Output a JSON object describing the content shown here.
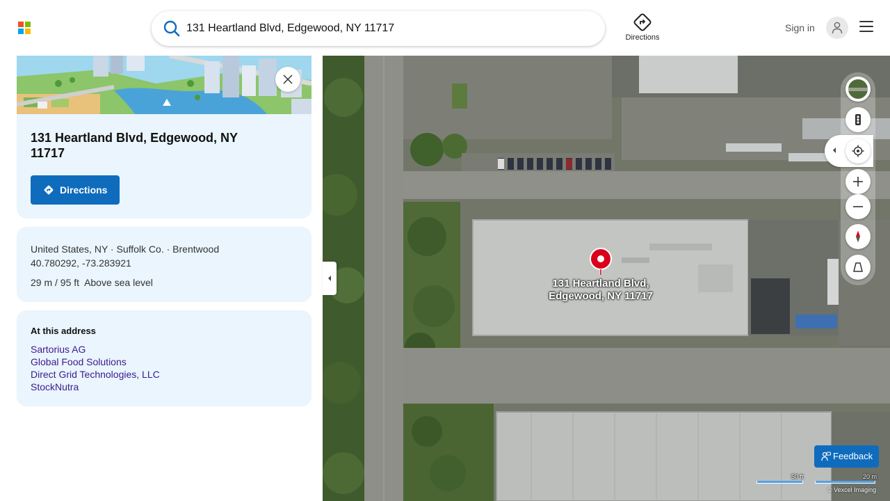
{
  "header": {
    "search_value": "131 Heartland Blvd, Edgewood, NY 11717",
    "directions_label": "Directions",
    "sign_in_label": "Sign in",
    "logo_colors": [
      "#f25022",
      "#7fba00",
      "#00a4ef",
      "#ffb900"
    ]
  },
  "place": {
    "title": "131 Heartland Blvd, Edgewood, NY 11717",
    "directions_button": "Directions",
    "region_country": "United States, NY",
    "region_county": "Suffolk Co.",
    "region_locality": "Brentwood",
    "separator": "·",
    "coordinates": "40.780292, -73.283921",
    "elevation": "29 m / 95 ft",
    "elevation_label": "Above sea level"
  },
  "at_address": {
    "heading": "At this address",
    "businesses": [
      "Sartorius AG",
      "Global Food Solutions",
      "Direct Grid Technologies, LLC",
      "StockNutra"
    ]
  },
  "map": {
    "pin_label_line1": "131 Heartland Blvd,",
    "pin_label_line2": "Edgewood, NY 11717",
    "feedback_label": "Feedback",
    "scale_ft": "50 ft",
    "scale_m": "20 m",
    "credit": "© Vexcel Imaging",
    "accent_color": "#0f6cbd",
    "pin_color": "#d8001b"
  }
}
